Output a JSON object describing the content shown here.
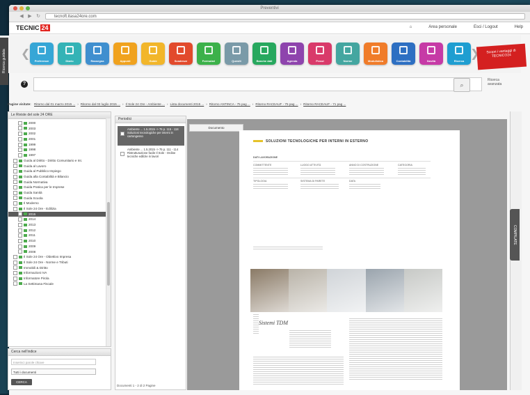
{
  "window": {
    "title": "Preventivi"
  },
  "browser": {
    "url": "tecnoft.itasa24ore.com"
  },
  "app": {
    "logo_text": "TECNIC",
    "logo_badge": "24",
    "top_links": [
      "Area personale",
      "Esci / Logout",
      "Help"
    ]
  },
  "toolbar": {
    "prev": "❮",
    "next": "❯",
    "tiles": [
      {
        "label": "Preferenze",
        "color": "#36a6d6"
      },
      {
        "label": "Diario",
        "color": "#34b3b6"
      },
      {
        "label": "Rassegna",
        "color": "#3f8fcf"
      },
      {
        "label": "Appunti",
        "color": "#f0a21e"
      },
      {
        "label": "Guide",
        "color": "#f2b62a"
      },
      {
        "label": "Scadenze",
        "color": "#e24a2c"
      },
      {
        "label": "Formulari",
        "color": "#3cb14a"
      },
      {
        "label": "Quesiti",
        "color": "#7a9aa8"
      },
      {
        "label": "Banche dati",
        "color": "#27a85e"
      },
      {
        "label": "Agenda",
        "color": "#8e44ad"
      },
      {
        "label": "Prezzi",
        "color": "#d93a6a"
      },
      {
        "label": "Norme",
        "color": "#44a6a0"
      },
      {
        "label": "Modulistica",
        "color": "#f07c2a"
      },
      {
        "label": "Contabilità",
        "color": "#2d6fc2"
      },
      {
        "label": "Novità",
        "color": "#c63aa6"
      },
      {
        "label": "Ricerca",
        "color": "#1f9ed1"
      }
    ],
    "promo": "Scopri i vantaggi di TECNICO24"
  },
  "sidebar_tab": "Ricerca guidata",
  "search": {
    "placeholder": "",
    "hint_line1": "Ricerca",
    "hint_line2": "avanzata"
  },
  "breadcrumbs": {
    "label": "Pagine visitate:",
    "items": [
      "Ritorno dal 01 marzo 2015 ...",
      "Ritorno dal 03 luglio 2015 ...",
      "Il Sole 24 Ore - Ambiente ...",
      "Lista documenti 2015 ...",
      "Ritorno ANTINCA - 75 pag ...",
      "Ritorno RACEAUF - 75 pag ...",
      "Ritorno RACEAUF - 71 pag ..."
    ]
  },
  "left_panel": {
    "title": "Le Riviste del sole 24 ORE",
    "rows": [
      {
        "text": "2000",
        "indent": 2
      },
      {
        "text": "2003",
        "indent": 2
      },
      {
        "text": "2002",
        "indent": 2
      },
      {
        "text": "2001",
        "indent": 2
      },
      {
        "text": "1999",
        "indent": 2
      },
      {
        "text": "1998",
        "indent": 2
      },
      {
        "text": "1997",
        "indent": 2
      },
      {
        "text": "Guida al Diritto - Diritto Comunitario e Int.",
        "indent": 1
      },
      {
        "text": "Guida al Lavoro",
        "indent": 1
      },
      {
        "text": "Guida al Pubblico Impiego",
        "indent": 1
      },
      {
        "text": "Guida alla Contabilità e Bilancio",
        "indent": 1
      },
      {
        "text": "Guida Normativa",
        "indent": 1
      },
      {
        "text": "Guida Pratica per le Imprese",
        "indent": 1
      },
      {
        "text": "Guida Sanità",
        "indent": 1
      },
      {
        "text": "Guida Scuola",
        "indent": 1
      },
      {
        "text": "Il Moderno",
        "indent": 1
      },
      {
        "text": "Il Sole 24 Ore - Edilizia",
        "indent": 1
      },
      {
        "text": "2015",
        "indent": 2,
        "selected": true
      },
      {
        "text": "2014",
        "indent": 2
      },
      {
        "text": "2013",
        "indent": 2
      },
      {
        "text": "2012",
        "indent": 2
      },
      {
        "text": "2011",
        "indent": 2
      },
      {
        "text": "2010",
        "indent": 2
      },
      {
        "text": "2009",
        "indent": 2
      },
      {
        "text": "2008",
        "indent": 2
      },
      {
        "text": "Il Sole 24 Ore - Obiettivo Impresa",
        "indent": 1
      },
      {
        "text": "Il Sole 24 Ore - Norme e Tributi",
        "indent": 1
      },
      {
        "text": "Immobili & Diritto",
        "indent": 1
      },
      {
        "text": "Informazioni IVA",
        "indent": 1
      },
      {
        "text": "Informatore Pirola",
        "indent": 1
      },
      {
        "text": "La Settimana Fiscale",
        "indent": 1
      }
    ]
  },
  "search_panel": {
    "title": "Cerca nell'indice",
    "placeholder": "Inserisci parole chiave",
    "select_value": "Tutti i documenti",
    "button": "CERCA"
  },
  "middle_panel": {
    "title": "Periodici",
    "cards": [
      "Ambiente ... 1.5.2015 -> 75 p. 115 - 118 Soluzioni tecnologiche per interni in cartongesso",
      "Ambiente ... 1.5.2015 -> 75 p. 111 - 114 Ristrutturazione facile Il Sole - Ordine tecniche edilizie in lavori"
    ],
    "pager": "Documenti  1 - 2 di 2  Pagine"
  },
  "viewer": {
    "tab": "Documento",
    "doc_title": "SOLUZIONI TECNOLOGICHE PER INTERNI IN ESTERNO",
    "section": "DATI LAVORAZIONE",
    "fields": [
      "COMMITTENTE",
      "LUOGO ATTIVITÀ",
      "ANNO DI COSTRUZIONE",
      "CATEGORIA",
      "TIPOLOGIA",
      "SISTEMA DI PARETE",
      "DATA"
    ],
    "heading_italic": "Sistemi TDM",
    "photo_colors": [
      "#8a7a66",
      "#b9b3a8",
      "#d0d4d8",
      "#9aa4ad",
      "#c7c9c6"
    ]
  },
  "right_rail": {
    "tab": "COMPILATE"
  },
  "colors": {
    "accent": "#e2241f",
    "selected": "#5a5a5a",
    "doc_rule": "#e6c22a"
  }
}
